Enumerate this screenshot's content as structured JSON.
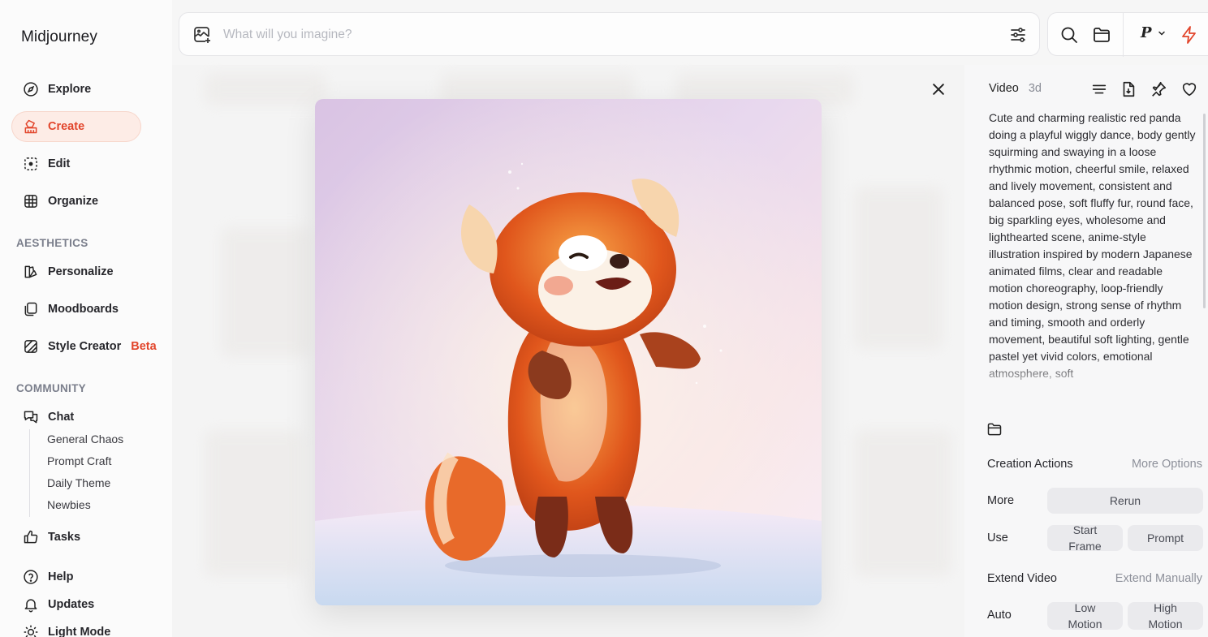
{
  "app": {
    "name": "Midjourney"
  },
  "nav": {
    "explore": "Explore",
    "create": "Create",
    "edit": "Edit",
    "organize": "Organize",
    "aesthetics_head": "AESTHETICS",
    "personalize": "Personalize",
    "moodboards": "Moodboards",
    "style_creator": "Style Creator",
    "beta_badge": "Beta",
    "community_head": "COMMUNITY",
    "chat": "Chat",
    "chat_channels": [
      "General Chaos",
      "Prompt Craft",
      "Daily Theme",
      "Newbies"
    ],
    "tasks": "Tasks",
    "help": "Help",
    "updates": "Updates",
    "light_mode": "Light Mode"
  },
  "search": {
    "placeholder": "What will you imagine?"
  },
  "profile": {
    "initial": "P"
  },
  "accent_color": "#e2452b",
  "panel": {
    "type": "Video",
    "age": "3d",
    "prompt": "Cute and charming realistic red panda doing a playful wiggly dance, body gently squirming and swaying in a loose rhythmic motion, cheerful smile, relaxed and lively movement, consistent and balanced pose, soft fluffy fur, round face, big sparkling eyes, wholesome and lighthearted scene, anime-style illustration inspired by modern Japanese animated films, clear and readable motion choreography, loop-friendly motion design, strong sense of rhythm and timing, smooth and orderly movement, beautiful soft lighting, gentle pastel yet vivid colors, emotional atmosphere, soft",
    "creation_actions": "Creation Actions",
    "more_options": "More Options",
    "more_label": "More",
    "rerun": "Rerun",
    "use_label": "Use",
    "start_frame": "Start Frame",
    "prompt_btn": "Prompt",
    "extend_video": "Extend Video",
    "extend_manually": "Extend Manually",
    "auto_label": "Auto",
    "low_motion": "Low Motion",
    "high_motion": "High Motion"
  }
}
